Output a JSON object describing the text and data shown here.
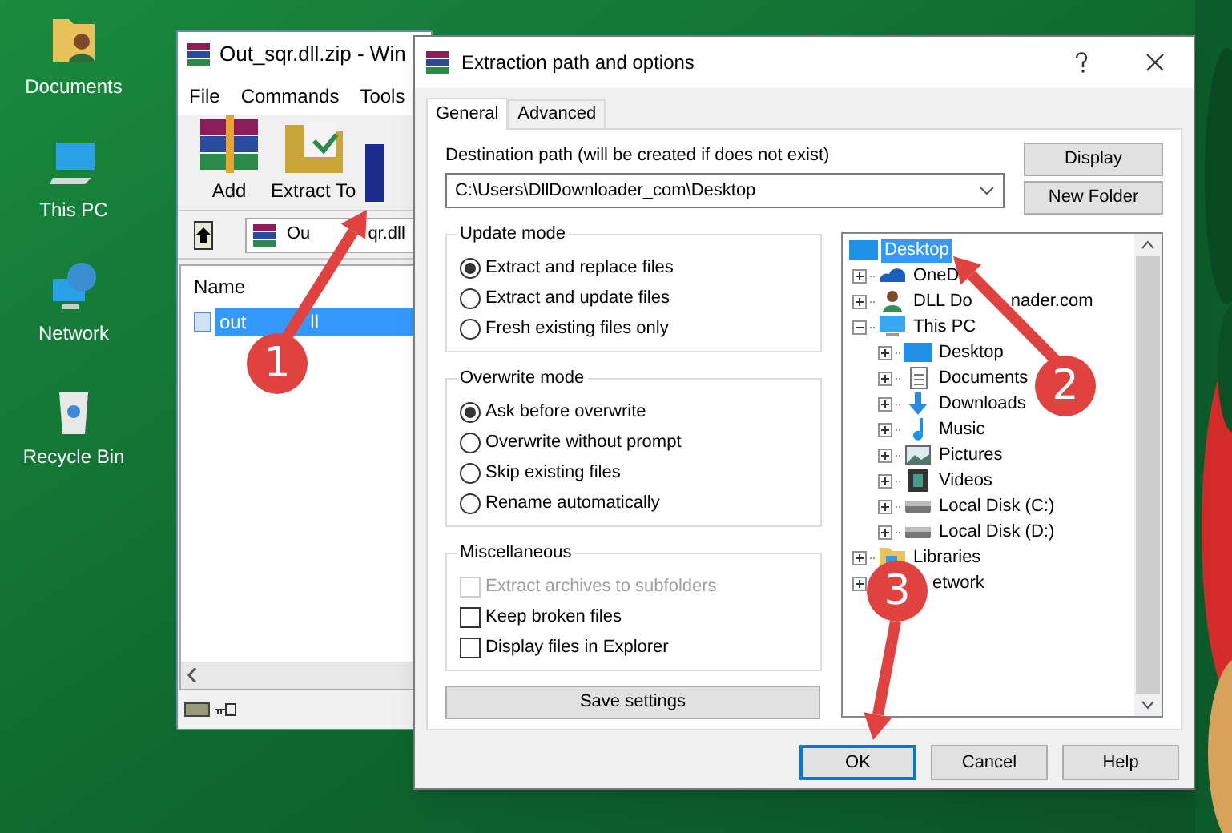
{
  "desktop_icons": [
    {
      "label": "Documents",
      "kind": "documents"
    },
    {
      "label": "This PC",
      "kind": "pc"
    },
    {
      "label": "Network",
      "kind": "network"
    },
    {
      "label": "Recycle Bin",
      "kind": "bin"
    }
  ],
  "archiver": {
    "title": "Out_sqr.dll.zip - Win",
    "menu": [
      "File",
      "Commands",
      "Tools"
    ],
    "toolbar": [
      {
        "label": "Add",
        "kind": "add"
      },
      {
        "label": "Extract To",
        "kind": "extract"
      },
      {
        "kind": "book"
      }
    ],
    "address": "Ou",
    "address_after": "qr.dll",
    "column": "Name",
    "files": [
      {
        "name": "out",
        "name_after": "ll",
        "selected": true
      }
    ]
  },
  "dialog": {
    "title": "Extraction path and options",
    "tabs": [
      {
        "label": "General",
        "selected": true
      },
      {
        "label": "Advanced",
        "selected": false
      }
    ],
    "destination_label": "Destination path (will be created if does not exist)",
    "destination_path": "C:\\Users\\DllDownloader_com\\Desktop",
    "side_buttons": [
      "Display",
      "New Folder"
    ],
    "groups": [
      {
        "title": "Update mode",
        "options": [
          {
            "kind": "radio",
            "label": "Extract and replace files",
            "checked": true,
            "disabled": false
          },
          {
            "kind": "radio",
            "label": "Extract and update files",
            "checked": false,
            "disabled": false
          },
          {
            "kind": "radio",
            "label": "Fresh existing files only",
            "checked": false,
            "disabled": false
          }
        ]
      },
      {
        "title": "Overwrite mode",
        "options": [
          {
            "kind": "radio",
            "label": "Ask before overwrite",
            "checked": true,
            "disabled": false
          },
          {
            "kind": "radio",
            "label": "Overwrite without prompt",
            "checked": false,
            "disabled": false
          },
          {
            "kind": "radio",
            "label": "Skip existing files",
            "checked": false,
            "disabled": false
          },
          {
            "kind": "radio",
            "label": "Rename automatically",
            "checked": false,
            "disabled": false
          }
        ]
      },
      {
        "title": "Miscellaneous",
        "options": [
          {
            "kind": "checkbox",
            "label": "Extract archives to subfolders",
            "checked": false,
            "disabled": true
          },
          {
            "kind": "checkbox",
            "label": "Keep broken files",
            "checked": false,
            "disabled": false
          },
          {
            "kind": "checkbox",
            "label": "Display files in Explorer",
            "checked": false,
            "disabled": false
          }
        ]
      }
    ],
    "save_button": "Save settings",
    "tree": [
      {
        "label": "Desktop",
        "kind": "desktop",
        "selected": true,
        "children": [
          {
            "label": "OneD",
            "kind": "cloud",
            "selected": false,
            "expanded": false
          },
          {
            "label": "DLL Do",
            "label_after": "nader.com",
            "kind": "user",
            "selected": false,
            "expanded": false
          },
          {
            "label": "This PC",
            "kind": "pc",
            "selected": false,
            "expanded": true,
            "children": [
              {
                "label": "Desktop",
                "kind": "desktop",
                "selected": false,
                "expanded": false
              },
              {
                "label": "Documents",
                "kind": "doc",
                "selected": false,
                "expanded": false
              },
              {
                "label": "Downloads",
                "kind": "download",
                "selected": false,
                "expanded": false
              },
              {
                "label": "Music",
                "kind": "music",
                "selected": false,
                "expanded": false
              },
              {
                "label": "Pictures",
                "kind": "pictures",
                "selected": false,
                "expanded": false
              },
              {
                "label": "Videos",
                "kind": "video",
                "selected": false,
                "expanded": false
              },
              {
                "label": "Local Disk (C:)",
                "kind": "disk",
                "selected": false,
                "expanded": false
              },
              {
                "label": "Local Disk (D:)",
                "kind": "disk",
                "selected": false,
                "expanded": false
              }
            ]
          },
          {
            "label": "Libraries",
            "kind": "folder",
            "selected": false,
            "expanded": false
          },
          {
            "label": "etwork",
            "kind": "covered",
            "selected": false,
            "expanded": false
          }
        ]
      }
    ],
    "buttons": [
      {
        "label": "OK",
        "default": true
      },
      {
        "label": "Cancel",
        "default": false
      },
      {
        "label": "Help",
        "default": false
      }
    ]
  },
  "annotations": [
    {
      "number": "1"
    },
    {
      "number": "2"
    },
    {
      "number": "3"
    }
  ]
}
